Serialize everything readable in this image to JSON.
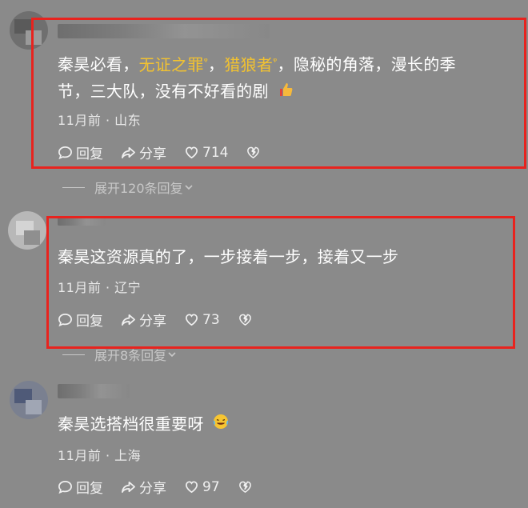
{
  "comments": [
    {
      "text_parts": [
        "秦昊必看，",
        "无证之罪",
        "，",
        "猎狼者",
        "，隐秘的角落，漫长的季",
        "节，三大队，没有不好看的剧"
      ],
      "meta": "11月前 · 山东",
      "reply_label": "回复",
      "share_label": "分享",
      "like_count": "714",
      "expand_label": "展开120条回复"
    },
    {
      "text": "秦昊这资源真的了，一步接着一步，接着又一步",
      "meta": "11月前 · 辽宁",
      "reply_label": "回复",
      "share_label": "分享",
      "like_count": "73",
      "expand_label": "展开8条回复"
    },
    {
      "text": "秦昊选搭档很重要呀",
      "meta": "11月前 · 上海",
      "reply_label": "回复",
      "share_label": "分享",
      "like_count": "97"
    }
  ],
  "colors": {
    "background": "#8a8a8a",
    "highlight": "#f2c230",
    "annotation_box": "#e8231e"
  }
}
